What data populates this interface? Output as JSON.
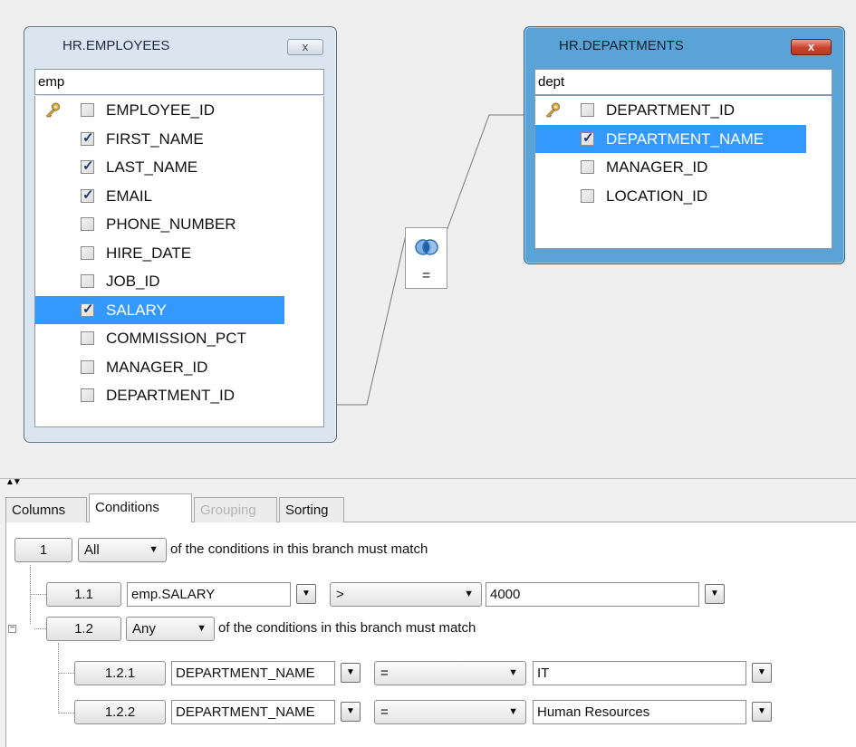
{
  "employees_table": {
    "title": "HR.EMPLOYEES",
    "close_label": "x",
    "alias": "emp",
    "columns": [
      {
        "name": "EMPLOYEE_ID",
        "checked": false,
        "key": true,
        "selected": false
      },
      {
        "name": "FIRST_NAME",
        "checked": true,
        "key": false,
        "selected": false
      },
      {
        "name": "LAST_NAME",
        "checked": true,
        "key": false,
        "selected": false
      },
      {
        "name": "EMAIL",
        "checked": true,
        "key": false,
        "selected": false
      },
      {
        "name": "PHONE_NUMBER",
        "checked": false,
        "key": false,
        "selected": false
      },
      {
        "name": "HIRE_DATE",
        "checked": false,
        "key": false,
        "selected": false
      },
      {
        "name": "JOB_ID",
        "checked": false,
        "key": false,
        "selected": false
      },
      {
        "name": "SALARY",
        "checked": true,
        "key": false,
        "selected": true
      },
      {
        "name": "COMMISSION_PCT",
        "checked": false,
        "key": false,
        "selected": false
      },
      {
        "name": "MANAGER_ID",
        "checked": false,
        "key": false,
        "selected": false
      },
      {
        "name": "DEPARTMENT_ID",
        "checked": false,
        "key": false,
        "selected": false
      }
    ]
  },
  "departments_table": {
    "title": "HR.DEPARTMENTS",
    "close_label": "x",
    "alias": "dept",
    "columns": [
      {
        "name": "DEPARTMENT_ID",
        "checked": false,
        "key": true,
        "selected": false
      },
      {
        "name": "DEPARTMENT_NAME",
        "checked": true,
        "key": false,
        "selected": true
      },
      {
        "name": "MANAGER_ID",
        "checked": false,
        "key": false,
        "selected": false
      },
      {
        "name": "LOCATION_ID",
        "checked": false,
        "key": false,
        "selected": false
      }
    ]
  },
  "join": {
    "operator": "=",
    "icon": "venn-inner-join-icon"
  },
  "tabs": [
    {
      "label": "Columns",
      "state": "normal"
    },
    {
      "label": "Conditions",
      "state": "active"
    },
    {
      "label": "Grouping",
      "state": "disabled"
    },
    {
      "label": "Sorting",
      "state": "normal"
    }
  ],
  "conditions": {
    "root": {
      "id": "1",
      "mode": "All",
      "text": "of the conditions in this branch must match"
    },
    "c11": {
      "id": "1.1",
      "field": "emp.SALARY",
      "operator": ">",
      "value": "4000"
    },
    "c12": {
      "id": "1.2",
      "mode": "Any",
      "text": "of the conditions in this branch must match",
      "expander": "−"
    },
    "c121": {
      "id": "1.2.1",
      "field": "DEPARTMENT_NAME",
      "operator": "=",
      "value": "IT"
    },
    "c122": {
      "id": "1.2.2",
      "field": "DEPARTMENT_NAME",
      "operator": "=",
      "value": "Human Resources"
    }
  },
  "glyphs": {
    "combo_arrow": "▼",
    "dropdown_arrow": "▼",
    "split_up": "▲",
    "split_down": "▼"
  }
}
